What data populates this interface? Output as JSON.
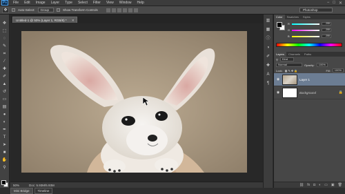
{
  "app": {
    "logo": "Ps"
  },
  "menu": [
    "File",
    "Edit",
    "Image",
    "Layer",
    "Type",
    "Select",
    "Filter",
    "View",
    "Window",
    "Help"
  ],
  "window_controls": [
    "−",
    "□",
    "✕"
  ],
  "options_bar": {
    "tool_icon": "move-tool-icon",
    "auto_select_label": "Auto-Select:",
    "auto_select_value": "Group",
    "show_transform_label": "Show Transform Controls",
    "workspace": "Photoshop"
  },
  "document": {
    "tab_title": "Untitled-1 @ 50% (Layer 1, RGB/8) *",
    "close": "✕"
  },
  "status": {
    "zoom": "50%",
    "doc_size": "Doc: 5.93M/5.93M"
  },
  "bottom_tabs": [
    "Mini Bridge",
    "Timeline"
  ],
  "color_panel": {
    "tabs": [
      "Color",
      "Swatches",
      "Styles"
    ],
    "channels": [
      {
        "label": "R",
        "value": "255"
      },
      {
        "label": "G",
        "value": "255"
      },
      {
        "label": "B",
        "value": "255"
      }
    ]
  },
  "layers_panel": {
    "tabs": [
      "Layers",
      "Channels",
      "Paths"
    ],
    "filter_kind": "Kind",
    "blend_mode": "Normal",
    "opacity_label": "Opacity:",
    "opacity_value": "100%",
    "lock_label": "Lock:",
    "fill_label": "Fill:",
    "fill_value": "100%",
    "layers": [
      {
        "name": "Layer 1",
        "selected": true,
        "thumb": "fox"
      },
      {
        "name": "Background",
        "selected": false,
        "thumb": "white",
        "locked": true
      }
    ]
  },
  "colors": {
    "accent_selected_layer": "#6c7d93",
    "panel_bg": "#474747",
    "canvas_bg": "#282828"
  }
}
